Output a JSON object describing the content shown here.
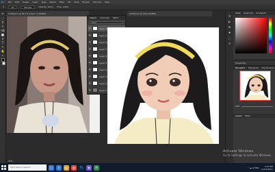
{
  "menubar": {
    "logo": "Ps",
    "items": [
      "File",
      "Edit",
      "Image",
      "Layer",
      "Type",
      "Select",
      "Filter",
      "3D",
      "View",
      "Plugins",
      "Window",
      "Help"
    ]
  },
  "options": {
    "tool": "Brush",
    "size": "20",
    "mode": "Normal",
    "opacity": "Opacity: 100%",
    "flow": "Flow: 100%"
  },
  "tools": [
    "⤧",
    "⬚",
    "⌗",
    "✎",
    "⌫",
    "⬤",
    "⌖",
    "T",
    "↖",
    "✋",
    "⌕"
  ],
  "colors": {
    "fg": "#000000",
    "bg": "#ffffff",
    "accent": "#31a8ff"
  },
  "doc1": {
    "tab": "Untitled-1 @ 66.7% (Layer 0, RGB/8)"
  },
  "layers_panel": {
    "tabs": [
      "Layers",
      "Channels",
      "Paths"
    ],
    "kind": "Kind",
    "rows": [
      "Layer 10",
      "Layer 9",
      "Layer 8",
      "Layer 7",
      "Layer 6",
      "Layer 5",
      "Layer 4",
      "Layer 3",
      "Layer 2",
      "Layer 1",
      "Layer 0"
    ]
  },
  "doc2": {
    "tab": "Untitled-2 @ 50% (RGB/8)"
  },
  "right_icons": [
    "☰",
    "◐",
    "⌘",
    "✚",
    "⬚",
    "☷"
  ],
  "color_panel": {
    "tabs": [
      "Color",
      "Swatches",
      "Gradients"
    ]
  },
  "properties": {
    "label": "Properties"
  },
  "navigator": {
    "tabs": [
      "Navigator",
      "Histogram",
      "Adjustments"
    ],
    "zoom": "50%"
  },
  "layers2": {
    "tabs": [
      "Layers",
      "Paths"
    ]
  },
  "status": {
    "text": "50%"
  },
  "activate": {
    "line1": "Activate Windows",
    "line2": "Go to Settings to activate Windows."
  },
  "taskbar": {
    "search": "Type here to search",
    "apps": [
      {
        "icon": "▢",
        "color": "#3b78d8"
      },
      {
        "icon": "e",
        "color": "#2a7ed6"
      },
      {
        "icon": "▤",
        "color": "#e0a526"
      },
      {
        "icon": "◉",
        "color": "#e84b3c"
      },
      {
        "icon": "Ps",
        "color": "#0b2a4a"
      },
      {
        "icon": "◆",
        "color": "#6b5bd6"
      },
      {
        "icon": "✉",
        "color": "#2e8b57"
      }
    ],
    "tray": "⌃  ☁  ⊡  ENG",
    "time": "4:15 PM",
    "date": "11/22/2021"
  }
}
